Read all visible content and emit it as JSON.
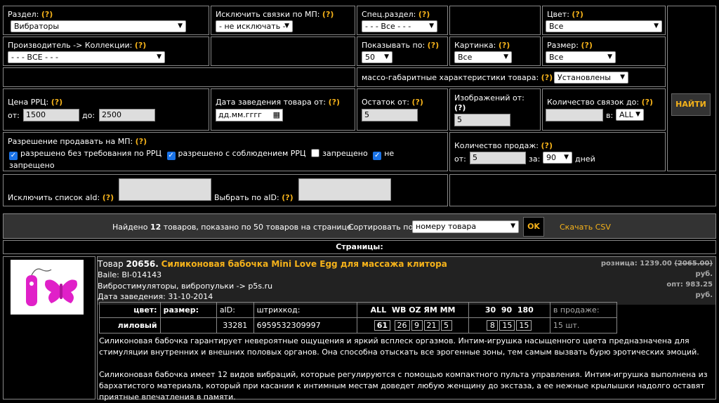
{
  "filters": {
    "section_label": "Раздел:",
    "section_value": "Вибраторы",
    "exclude_mp_label": "Исключить связки по МП:",
    "exclude_mp_value": "- не исключать -",
    "special_section_label": "Спец.раздел:",
    "special_section_value": "- - - Все - - -",
    "color_label": "Цвет:",
    "color_value": "Все",
    "manufacturer_label": "Производитель -> Коллекции:",
    "manufacturer_value": "- - - ВСЕ - - -",
    "show_by_label": "Показывать по:",
    "show_by_value": "50",
    "picture_label": "Картинка:",
    "picture_value": "Все",
    "size_label": "Размер:",
    "size_value": "Все",
    "dimensions_label": "массо-габаритные характеристики товара:",
    "dimensions_value": "Установлены",
    "price_label": "Цена РРЦ:",
    "price_from_label": "от:",
    "price_from": "1500",
    "price_to_label": "до:",
    "price_to": "2500",
    "date_label": "Дата заведения товара от:",
    "date_placeholder": "дд.мм.гггг",
    "stock_label": "Остаток от:",
    "stock_value": "5",
    "images_label": "Изображений от:",
    "images_value": "5",
    "links_label": "Количество связок до:",
    "links_in_label": "в:",
    "links_in_value": "ALL",
    "permission_label": "Разрешение продавать на МП:",
    "perm1": "разрешено без требования по РРЦ",
    "perm2": "разрешено с соблюдением РРЦ",
    "perm3": "запрещено",
    "perm4": "не запрещено",
    "sales_label": "Количество продаж:",
    "sales_from_label": "от:",
    "sales_from": "5",
    "sales_for_label": "за:",
    "sales_days_value": "90",
    "sales_days_label": "дней",
    "exclude_list_label": "Исключить список aId:",
    "select_by_label": "Выбрать по aID:",
    "help": "(?)",
    "find_button": "НАЙТИ"
  },
  "results": {
    "found_prefix": "Найдено ",
    "found_count": "12",
    "found_suffix": " товаров, показано по 50 товаров на странице.",
    "sort_label": "Сортировать по:",
    "sort_value": "номеру товара",
    "ok_button": "OK",
    "csv_link": "Скачать CSV",
    "pages_label": "Страницы:"
  },
  "product": {
    "prefix": "Товар ",
    "id": "20656.",
    "title": "Силиконовая бабочка Mini Love Egg для массажа клитора",
    "sku": "Baile: BI-014143",
    "category": "Вибростимуляторы, вибропульки -> p5s.ru",
    "date": "Дата заведения: 31-10-2014",
    "retail_label": "розница: 1239.00",
    "retail_old": "(2065.00)",
    "currency1": "руб.",
    "wholesale_label": "опт: 983.25",
    "currency2": "руб.",
    "headers": [
      "цвет:",
      "размер:",
      "aID:",
      "штрихкод:",
      "ALL  WB OZ ЯМ ММ",
      "30  90  180",
      "в продаже:"
    ],
    "row": {
      "color": "лиловый",
      "size": "",
      "aid": "33281",
      "barcode": "6959532309997",
      "mp": [
        "61",
        "26",
        "9",
        "21",
        "5"
      ],
      "periods": [
        "8",
        "15",
        "15"
      ],
      "on_sale": "15 шт."
    },
    "desc1": "Силиконовая бабочка гарантирует невероятные ощущения и яркий всплеск оргазмов. Интим-игрушка насыщенного цвета предназначена для стимуляции внутренних и внешних половых органов. Она способна отыскать все эрогенные зоны, тем самым вызвать бурю эротических эмоций.",
    "desc2": "Силиконовая бабочка имеет 12 видов вибраций, которые регулируются с помощью компактного пульта управления. Интим-игрушка выполнена из бархатистого материала, который при касании к интимным местам доведет любую женщину до экстаза, а ее нежные крылышки надолго оставят приятные впечатления в памяти."
  },
  "colors": {
    "accent": "#f5b21a",
    "panel": "#333333",
    "checkbox": "#1a73e8",
    "product_image_pink": "#e020c8"
  }
}
